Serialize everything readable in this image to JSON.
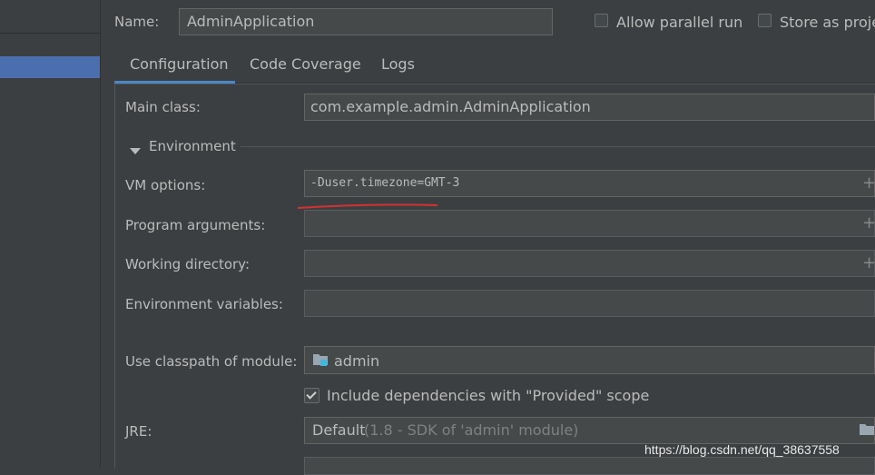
{
  "header": {
    "name_label": "Name:",
    "name_value": "AdminApplication",
    "allow_parallel_label": "Allow parallel run",
    "store_as_project_label": "Store as projec"
  },
  "tabs": [
    {
      "label": "Configuration",
      "active": true
    },
    {
      "label": "Code Coverage",
      "active": false
    },
    {
      "label": "Logs",
      "active": false
    }
  ],
  "form": {
    "main_class_label": "Main class:",
    "main_class_value": "com.example.admin.AdminApplication",
    "environment_label": "Environment",
    "vm_options_label": "VM options:",
    "vm_options_value": "-Duser.timezone=GMT-3",
    "program_arguments_label": "Program arguments:",
    "working_directory_label": "Working directory:",
    "environment_variables_label": "Environment variables:",
    "classpath_label": "Use classpath of module:",
    "classpath_value": "admin",
    "include_deps_label": "Include dependencies with \"Provided\" scope",
    "jre_label": "JRE:",
    "jre_value": "Default",
    "jre_detail": "(1.8 - SDK of 'admin' module)",
    "plus_glyph": "+"
  },
  "watermark": "https://blog.csdn.net/qq_38637558",
  "colors": {
    "background": "#3c3f41",
    "field": "#45494a",
    "selection": "#4b6eaf",
    "tab_underline": "#4a88c7",
    "annotation_red": "#d23232"
  },
  "icons": {
    "environment_toggle": "triangle-down-icon",
    "module": "module-folder-icon",
    "jre_browse": "folder-icon"
  }
}
